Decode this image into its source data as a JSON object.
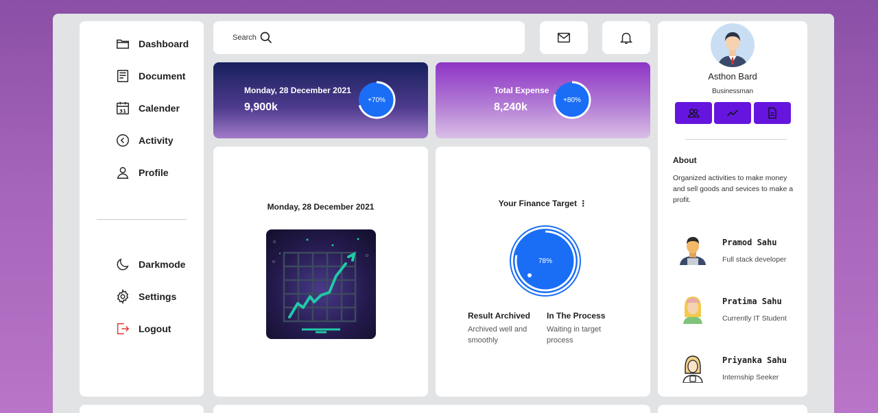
{
  "sidebar": {
    "top_items": [
      {
        "label": "Dashboard",
        "icon": "folder-icon"
      },
      {
        "label": "Document",
        "icon": "document-icon"
      },
      {
        "label": "Calender",
        "icon": "calendar-icon"
      },
      {
        "label": "Activity",
        "icon": "activity-icon"
      },
      {
        "label": "Profile",
        "icon": "user-icon"
      }
    ],
    "bottom_items": [
      {
        "label": "Darkmode",
        "icon": "moon-icon"
      },
      {
        "label": "Settings",
        "icon": "gear-icon"
      },
      {
        "label": "Logout",
        "icon": "logout-icon"
      }
    ]
  },
  "topbar": {
    "search_label": "Search"
  },
  "stats": [
    {
      "title": "Monday, 28 December 2021",
      "value": "9,900k",
      "percent_label": "+70%",
      "percent": 70
    },
    {
      "title": "Total Expense",
      "value": "8,240k",
      "percent_label": "+80%",
      "percent": 80
    }
  ],
  "chart_card": {
    "date": "Monday, 28 December 2021"
  },
  "finance": {
    "title": "Your Finance Target",
    "percent_label": "78%",
    "percent": 78,
    "result": {
      "heading": "Result Archived",
      "text": "Archived well and smoothly"
    },
    "process": {
      "heading": "In The Process",
      "text": "Waiting in target process"
    }
  },
  "profile": {
    "name": "Asthon Bard",
    "role": "Businessman",
    "about_heading": "About",
    "about_text": "Organized activities to make money and sell goods and sevices to make a profit.",
    "people": [
      {
        "name": "Pramod Sahu",
        "role": "Full stack developer"
      },
      {
        "name": "Pratima Sahu",
        "role": "Currently IT Student"
      },
      {
        "name": "Priyanka Sahu",
        "role": "Internship Seeker"
      }
    ]
  },
  "colors": {
    "accent": "#1a6ef5",
    "button": "#6515dd",
    "logout": "#e53935"
  }
}
